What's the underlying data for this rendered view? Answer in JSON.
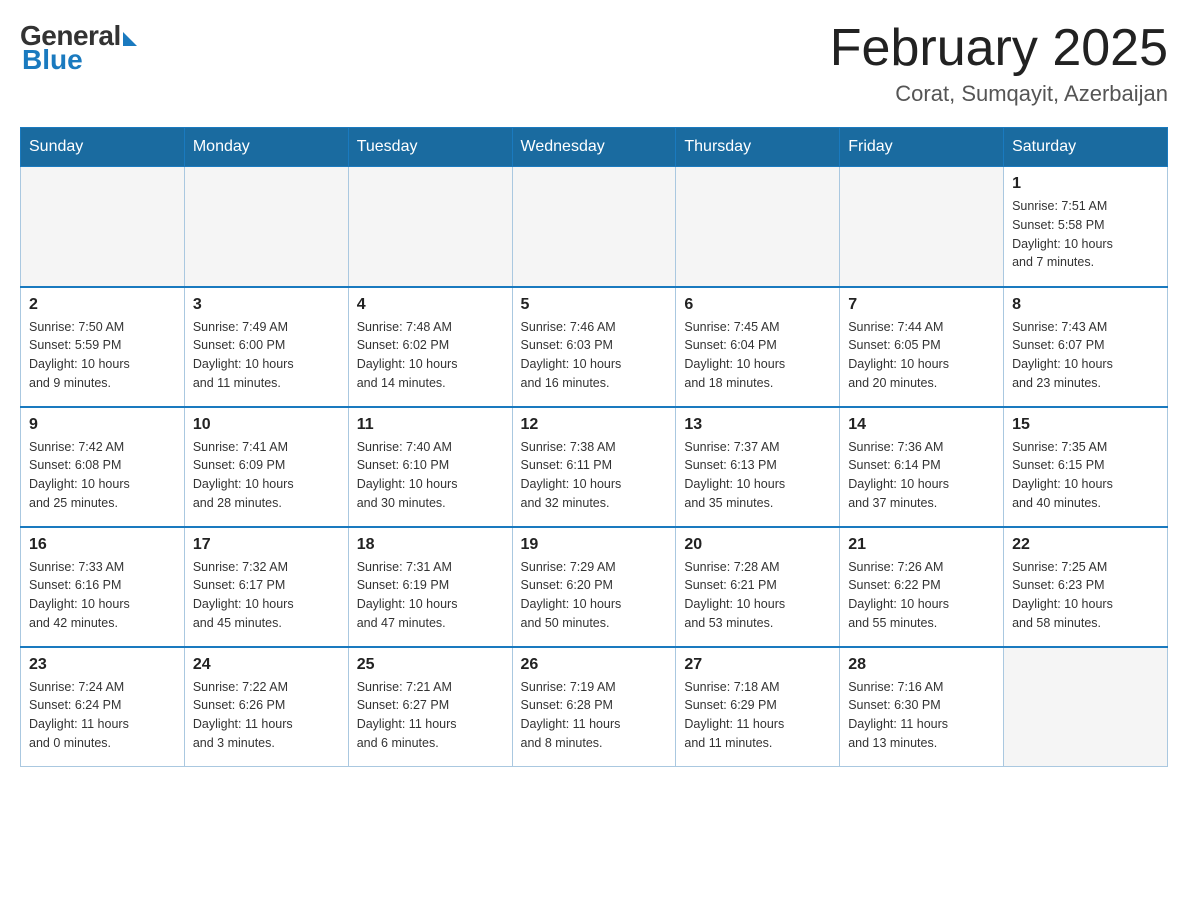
{
  "header": {
    "logo": {
      "general": "General",
      "blue": "Blue"
    },
    "title": "February 2025",
    "location": "Corat, Sumqayit, Azerbaijan"
  },
  "weekdays": [
    "Sunday",
    "Monday",
    "Tuesday",
    "Wednesday",
    "Thursday",
    "Friday",
    "Saturday"
  ],
  "weeks": [
    [
      {
        "day": "",
        "info": ""
      },
      {
        "day": "",
        "info": ""
      },
      {
        "day": "",
        "info": ""
      },
      {
        "day": "",
        "info": ""
      },
      {
        "day": "",
        "info": ""
      },
      {
        "day": "",
        "info": ""
      },
      {
        "day": "1",
        "info": "Sunrise: 7:51 AM\nSunset: 5:58 PM\nDaylight: 10 hours\nand 7 minutes."
      }
    ],
    [
      {
        "day": "2",
        "info": "Sunrise: 7:50 AM\nSunset: 5:59 PM\nDaylight: 10 hours\nand 9 minutes."
      },
      {
        "day": "3",
        "info": "Sunrise: 7:49 AM\nSunset: 6:00 PM\nDaylight: 10 hours\nand 11 minutes."
      },
      {
        "day": "4",
        "info": "Sunrise: 7:48 AM\nSunset: 6:02 PM\nDaylight: 10 hours\nand 14 minutes."
      },
      {
        "day": "5",
        "info": "Sunrise: 7:46 AM\nSunset: 6:03 PM\nDaylight: 10 hours\nand 16 minutes."
      },
      {
        "day": "6",
        "info": "Sunrise: 7:45 AM\nSunset: 6:04 PM\nDaylight: 10 hours\nand 18 minutes."
      },
      {
        "day": "7",
        "info": "Sunrise: 7:44 AM\nSunset: 6:05 PM\nDaylight: 10 hours\nand 20 minutes."
      },
      {
        "day": "8",
        "info": "Sunrise: 7:43 AM\nSunset: 6:07 PM\nDaylight: 10 hours\nand 23 minutes."
      }
    ],
    [
      {
        "day": "9",
        "info": "Sunrise: 7:42 AM\nSunset: 6:08 PM\nDaylight: 10 hours\nand 25 minutes."
      },
      {
        "day": "10",
        "info": "Sunrise: 7:41 AM\nSunset: 6:09 PM\nDaylight: 10 hours\nand 28 minutes."
      },
      {
        "day": "11",
        "info": "Sunrise: 7:40 AM\nSunset: 6:10 PM\nDaylight: 10 hours\nand 30 minutes."
      },
      {
        "day": "12",
        "info": "Sunrise: 7:38 AM\nSunset: 6:11 PM\nDaylight: 10 hours\nand 32 minutes."
      },
      {
        "day": "13",
        "info": "Sunrise: 7:37 AM\nSunset: 6:13 PM\nDaylight: 10 hours\nand 35 minutes."
      },
      {
        "day": "14",
        "info": "Sunrise: 7:36 AM\nSunset: 6:14 PM\nDaylight: 10 hours\nand 37 minutes."
      },
      {
        "day": "15",
        "info": "Sunrise: 7:35 AM\nSunset: 6:15 PM\nDaylight: 10 hours\nand 40 minutes."
      }
    ],
    [
      {
        "day": "16",
        "info": "Sunrise: 7:33 AM\nSunset: 6:16 PM\nDaylight: 10 hours\nand 42 minutes."
      },
      {
        "day": "17",
        "info": "Sunrise: 7:32 AM\nSunset: 6:17 PM\nDaylight: 10 hours\nand 45 minutes."
      },
      {
        "day": "18",
        "info": "Sunrise: 7:31 AM\nSunset: 6:19 PM\nDaylight: 10 hours\nand 47 minutes."
      },
      {
        "day": "19",
        "info": "Sunrise: 7:29 AM\nSunset: 6:20 PM\nDaylight: 10 hours\nand 50 minutes."
      },
      {
        "day": "20",
        "info": "Sunrise: 7:28 AM\nSunset: 6:21 PM\nDaylight: 10 hours\nand 53 minutes."
      },
      {
        "day": "21",
        "info": "Sunrise: 7:26 AM\nSunset: 6:22 PM\nDaylight: 10 hours\nand 55 minutes."
      },
      {
        "day": "22",
        "info": "Sunrise: 7:25 AM\nSunset: 6:23 PM\nDaylight: 10 hours\nand 58 minutes."
      }
    ],
    [
      {
        "day": "23",
        "info": "Sunrise: 7:24 AM\nSunset: 6:24 PM\nDaylight: 11 hours\nand 0 minutes."
      },
      {
        "day": "24",
        "info": "Sunrise: 7:22 AM\nSunset: 6:26 PM\nDaylight: 11 hours\nand 3 minutes."
      },
      {
        "day": "25",
        "info": "Sunrise: 7:21 AM\nSunset: 6:27 PM\nDaylight: 11 hours\nand 6 minutes."
      },
      {
        "day": "26",
        "info": "Sunrise: 7:19 AM\nSunset: 6:28 PM\nDaylight: 11 hours\nand 8 minutes."
      },
      {
        "day": "27",
        "info": "Sunrise: 7:18 AM\nSunset: 6:29 PM\nDaylight: 11 hours\nand 11 minutes."
      },
      {
        "day": "28",
        "info": "Sunrise: 7:16 AM\nSunset: 6:30 PM\nDaylight: 11 hours\nand 13 minutes."
      },
      {
        "day": "",
        "info": ""
      }
    ]
  ]
}
